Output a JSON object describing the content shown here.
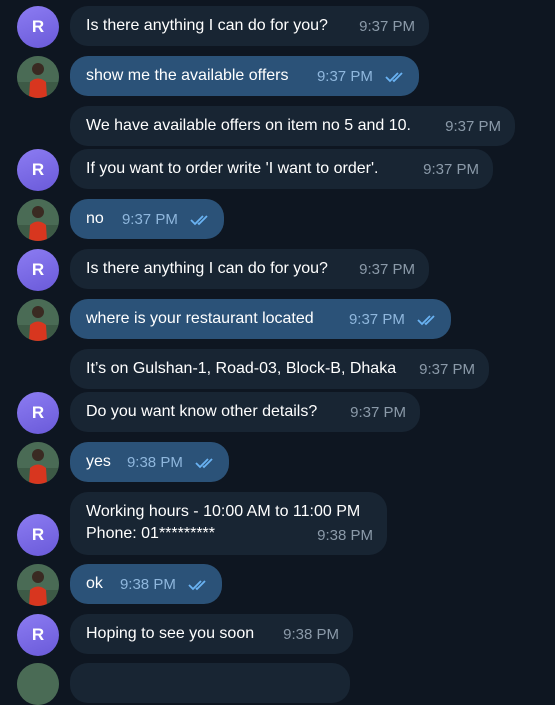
{
  "avatar_bot_letter": "R",
  "colors": {
    "background": "#0e1621",
    "incoming_bubble": "#182533",
    "outgoing_bubble": "#2b5278",
    "bot_avatar": "#7b6be6",
    "timestamp": "#8b9aa9",
    "read_check": "#6ab3f3"
  },
  "messages": [
    {
      "from": "bot",
      "avatar": true,
      "text": "Is there anything I can do for you?",
      "time": "9:37 PM"
    },
    {
      "from": "user",
      "avatar": true,
      "text": "show me the available offers",
      "time": "9:37 PM",
      "status": "read"
    },
    {
      "from": "bot",
      "avatar": false,
      "text": "We have available offers on item no 5 and 10.",
      "time": "9:37 PM"
    },
    {
      "from": "bot",
      "avatar": true,
      "text": "If you want to order write 'I want to order'.",
      "time": "9:37 PM"
    },
    {
      "from": "user",
      "avatar": true,
      "text": "no",
      "time": "9:37 PM",
      "status": "read"
    },
    {
      "from": "bot",
      "avatar": true,
      "text": "Is there anything I can do for you?",
      "time": "9:37 PM"
    },
    {
      "from": "user",
      "avatar": true,
      "text": "where is your restaurant located",
      "time": "9:37 PM",
      "status": "read"
    },
    {
      "from": "bot",
      "avatar": false,
      "text": "It’s on Gulshan-1, Road-03, Block-B, Dhaka",
      "time": "9:37 PM"
    },
    {
      "from": "bot",
      "avatar": true,
      "text": "Do you want know other details?",
      "time": "9:37 PM"
    },
    {
      "from": "user",
      "avatar": true,
      "text": "yes",
      "time": "9:38 PM",
      "status": "read"
    },
    {
      "from": "bot",
      "avatar": true,
      "text_lines": [
        "Working hours - 10:00 AM to 11:00 PM",
        "Phone: 01*********"
      ],
      "time": "9:38 PM"
    },
    {
      "from": "user",
      "avatar": true,
      "text": "ok",
      "time": "9:38 PM",
      "status": "read"
    },
    {
      "from": "bot",
      "avatar": true,
      "text": "Hoping to see you soon",
      "time": "9:38 PM"
    }
  ]
}
